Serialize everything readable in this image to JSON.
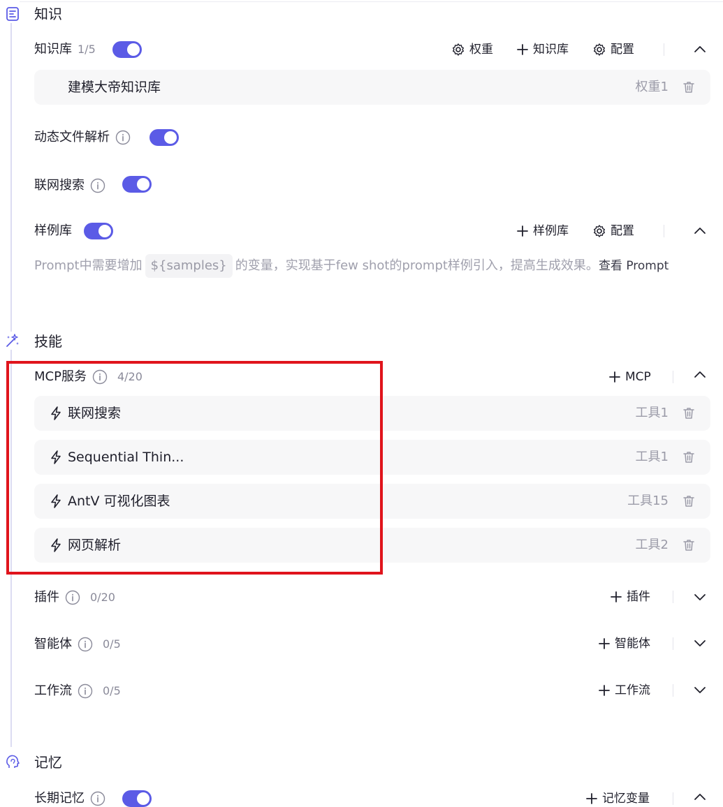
{
  "knowledge": {
    "title": "知识",
    "icon": "document-icon",
    "kb": {
      "label": "知识库",
      "count": "1/5",
      "enabled": true,
      "actions": {
        "weight": "权重",
        "add": "知识库",
        "config": "配置"
      },
      "items": [
        {
          "name": "建模大帝知识库",
          "meta": "权重1"
        }
      ]
    },
    "dynamic_parse": {
      "label": "动态文件解析",
      "enabled": true
    },
    "web_search": {
      "label": "联网搜索",
      "enabled": true
    },
    "samples": {
      "label": "样例库",
      "enabled": true,
      "actions": {
        "add": "样例库",
        "config": "配置"
      },
      "desc_before": "Prompt中需要增加",
      "desc_code": "${samples}",
      "desc_after": "的变量，实现基于few shot的prompt样例引入，提高生成效果。",
      "link": "查看 Prompt"
    }
  },
  "skills": {
    "title": "技能",
    "icon": "magic-sparkle-icon",
    "mcp": {
      "label": "MCP服务",
      "count": "4/20",
      "add": "MCP",
      "items": [
        {
          "name": "联网搜索",
          "meta": "工具1"
        },
        {
          "name": "Sequential Thin...",
          "meta": "工具1"
        },
        {
          "name": "AntV 可视化图表",
          "meta": "工具15"
        },
        {
          "name": "网页解析",
          "meta": "工具2"
        }
      ]
    },
    "plugins": {
      "label": "插件",
      "count": "0/20",
      "add": "插件"
    },
    "agents": {
      "label": "智能体",
      "count": "0/5",
      "add": "智能体"
    },
    "workflows": {
      "label": "工作流",
      "count": "0/5",
      "add": "工作流"
    }
  },
  "memory": {
    "title": "记忆",
    "icon": "brain-head-icon",
    "long_term": {
      "label": "长期记忆",
      "enabled": true,
      "add": "记忆变量"
    }
  },
  "colors": {
    "accent": "#5b5be6",
    "highlight_border": "#e0141c"
  }
}
